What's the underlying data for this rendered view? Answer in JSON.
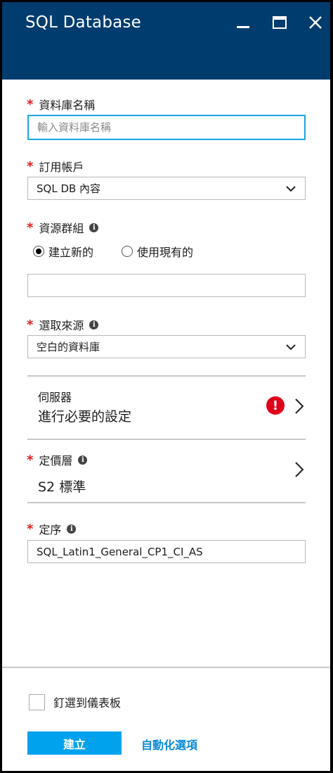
{
  "window": {
    "title": "SQL Database"
  },
  "fields": {
    "db_name": {
      "label": "資料庫名稱",
      "placeholder": "輸入資料庫名稱",
      "value": ""
    },
    "subscription": {
      "label": "訂用帳戶",
      "value": "SQL DB 內容"
    },
    "resource_group": {
      "label": "資源群組",
      "options": [
        {
          "label": "建立新的",
          "selected": true
        },
        {
          "label": "使用現有的",
          "selected": false
        }
      ],
      "value": ""
    },
    "source": {
      "label": "選取來源",
      "value": "空白的資料庫"
    },
    "server": {
      "label": "伺服器",
      "value": "進行必要的設定",
      "error_symbol": "!"
    },
    "pricing_tier": {
      "label": "定價層",
      "value": "S2 標準"
    },
    "collation": {
      "label": "定序",
      "value": "SQL_Latin1_General_CP1_CI_AS"
    }
  },
  "required_mark": "*",
  "info_symbol": "i",
  "footer": {
    "pin_label": "釘選到儀表板",
    "pin_checked": false,
    "create_label": "建立",
    "automation_label": "自動化選項"
  },
  "colors": {
    "header_bg": "#003c6e",
    "accent": "#00a2ed",
    "focus": "#1aa7e0",
    "required": "#e01e1e",
    "error": "#e0001a"
  }
}
